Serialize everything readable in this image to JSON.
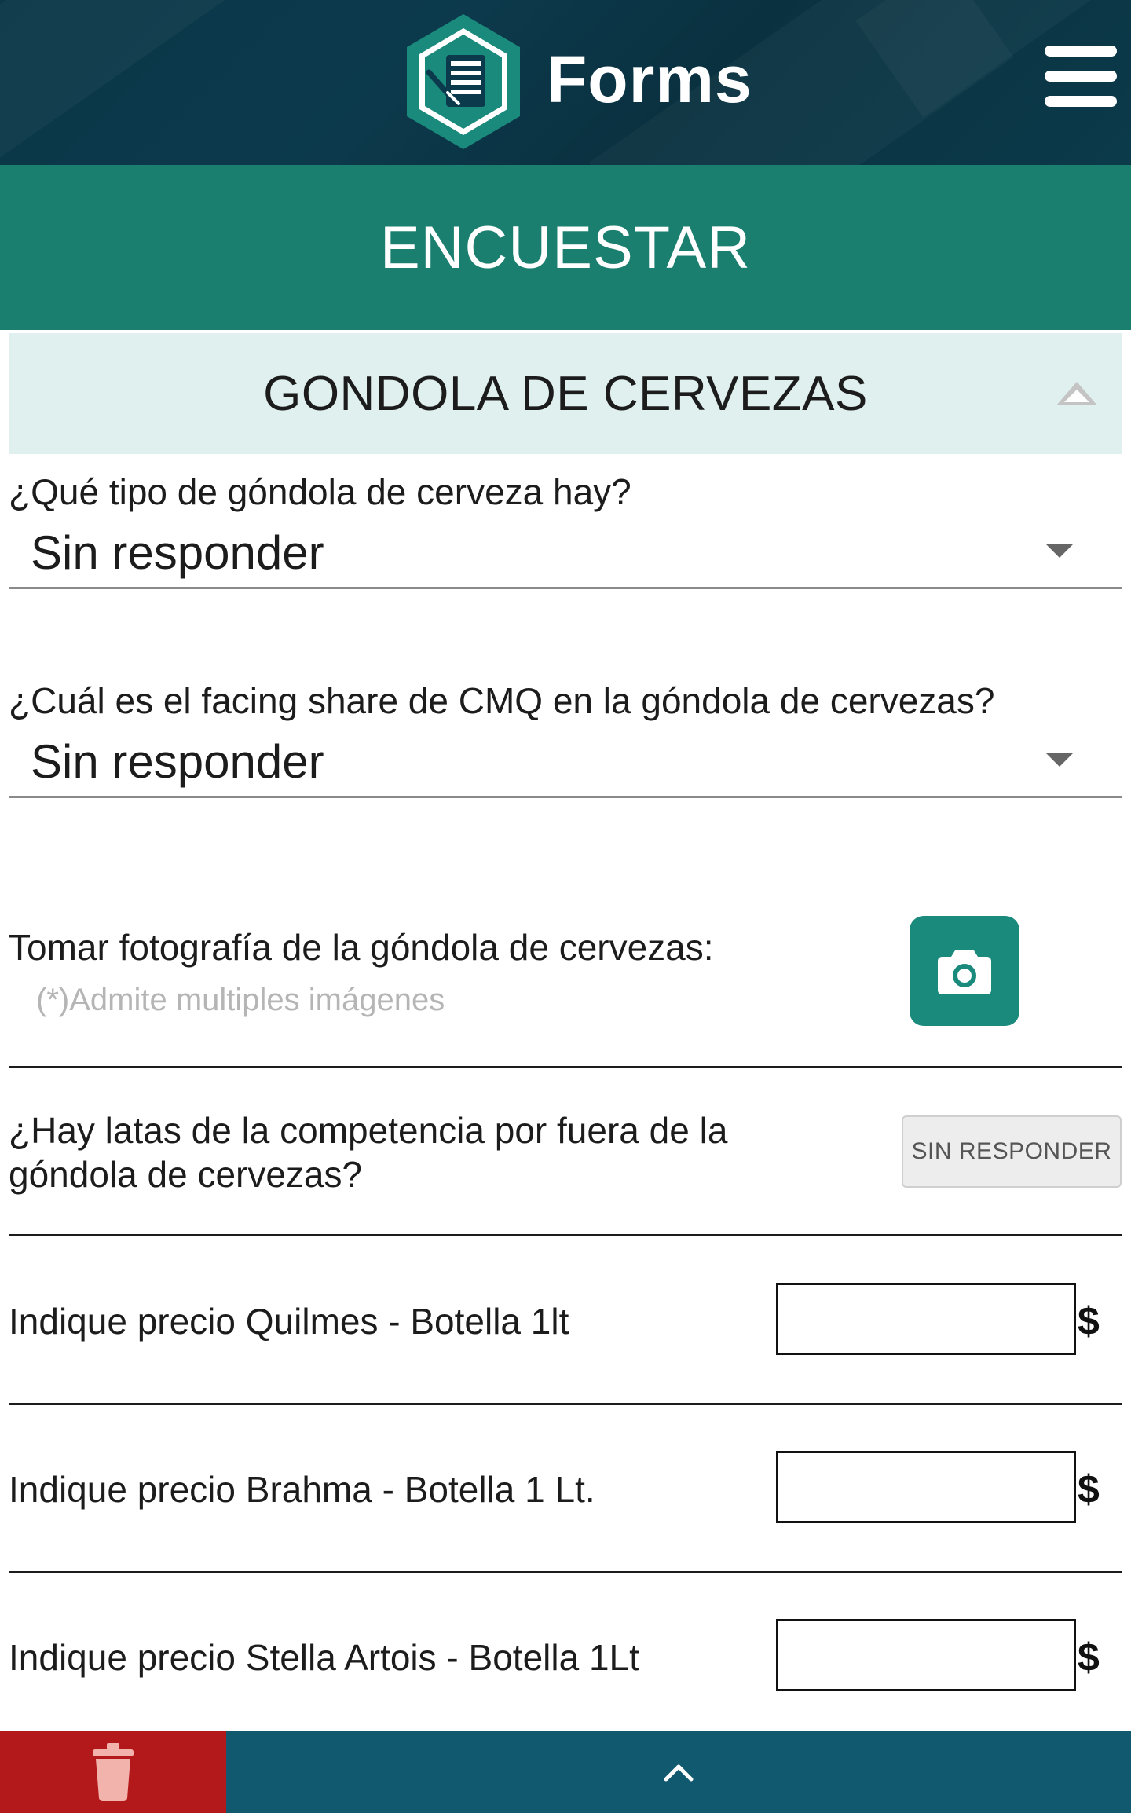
{
  "header": {
    "app_name": "Forms",
    "logo_icon": "form-document-icon",
    "menu_icon": "hamburger-menu-icon",
    "colors": {
      "background": "#0b3849",
      "logo_green": "#1a8a7c"
    }
  },
  "banner": {
    "title": "ENCUESTAR",
    "color": "#1b7f6f"
  },
  "section": {
    "title": "GONDOLA DE CERVEZAS",
    "expanded": true,
    "toggle_icon": "chevron-up-icon"
  },
  "questions": {
    "gondola_type": {
      "label": "¿Qué tipo de góndola de cerveza hay?",
      "value": "Sin responder"
    },
    "facing_share": {
      "label": "¿Cuál es el facing share de CMQ en la góndola de cervezas?",
      "value": "Sin responder"
    },
    "photo": {
      "label": "Tomar fotografía de la góndola de cervezas:",
      "hint": "(*)Admite multiples imágenes",
      "button_icon": "camera-icon"
    },
    "competitor_cans": {
      "label_line1": "¿Hay latas de la competencia por fuera de la",
      "label_line2": "góndola de cervezas?",
      "button_label": "SIN RESPONDER"
    },
    "price_quilmes": {
      "label": "Indique precio Quilmes - Botella 1lt",
      "value": "",
      "currency": "$"
    },
    "price_brahma": {
      "label": "Indique precio Brahma - Botella 1 Lt.",
      "value": "",
      "currency": "$"
    },
    "price_stella": {
      "label": "Indique precio Stella Artois - Botella 1Lt",
      "value": "",
      "currency": "$"
    }
  },
  "bottom_bar": {
    "delete_icon": "trash-icon",
    "scroll_icon": "chevron-up-icon",
    "colors": {
      "delete": "#b3191b",
      "nav": "#11596e"
    }
  }
}
